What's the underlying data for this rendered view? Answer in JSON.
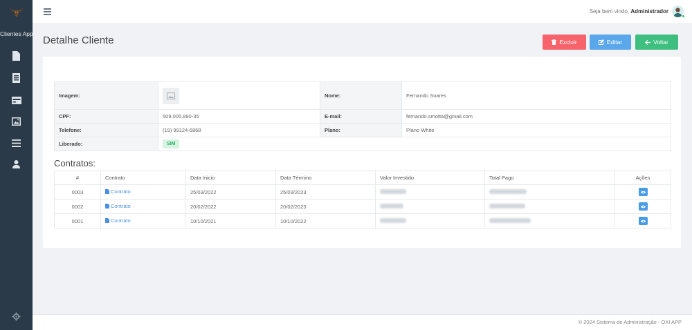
{
  "sidebar": {
    "app_name": "Clientes App",
    "items": [
      {
        "icon": "file-icon"
      },
      {
        "icon": "document-icon"
      },
      {
        "icon": "card-icon"
      },
      {
        "icon": "image-icon"
      },
      {
        "icon": "list-icon"
      },
      {
        "icon": "user-icon"
      }
    ],
    "footer_icon": "gear-icon"
  },
  "topbar": {
    "welcome_prefix": "Seja bem vindo,",
    "user_name": "Administrador"
  },
  "page": {
    "title": "Detalhe Cliente",
    "buttons": {
      "delete": "Excluir",
      "edit": "Editar",
      "back": "Voltar"
    }
  },
  "client": {
    "labels": {
      "image": "Imagem:",
      "name": "Nome:",
      "cpf": "CPF:",
      "email": "E-mail:",
      "phone": "Telefone:",
      "plan": "Plano:",
      "released": "Liberado:"
    },
    "name": "Fernando Soares",
    "cpf": "509.005.890-35",
    "email": "fernando.smotta@gmail.com",
    "phone": "(19) 99124-6868",
    "plan": "Plano White",
    "released": "SIM"
  },
  "contracts": {
    "title": "Contratos:",
    "headers": [
      "#",
      "Contrato",
      "Data Inicio",
      "Data Término",
      "Valor Investido",
      "Total Pago",
      "Ações"
    ],
    "rows": [
      {
        "id": "0003",
        "contract": "Contrato",
        "start": "25/03/2022",
        "end": "25/03/2023"
      },
      {
        "id": "0002",
        "contract": "Contrato",
        "start": "20/02/2022",
        "end": "20/02/2023"
      },
      {
        "id": "0001",
        "contract": "Contrato",
        "start": "10/10/2021",
        "end": "10/10/2022"
      }
    ]
  },
  "footer": {
    "text": "© 2024 Sistema de Administração - OXI APP"
  },
  "colors": {
    "sidebar": "#2b3a48",
    "delete": "#f7636b",
    "edit": "#5aa7ec",
    "back": "#3fbf7f",
    "link": "#4a90e2"
  }
}
